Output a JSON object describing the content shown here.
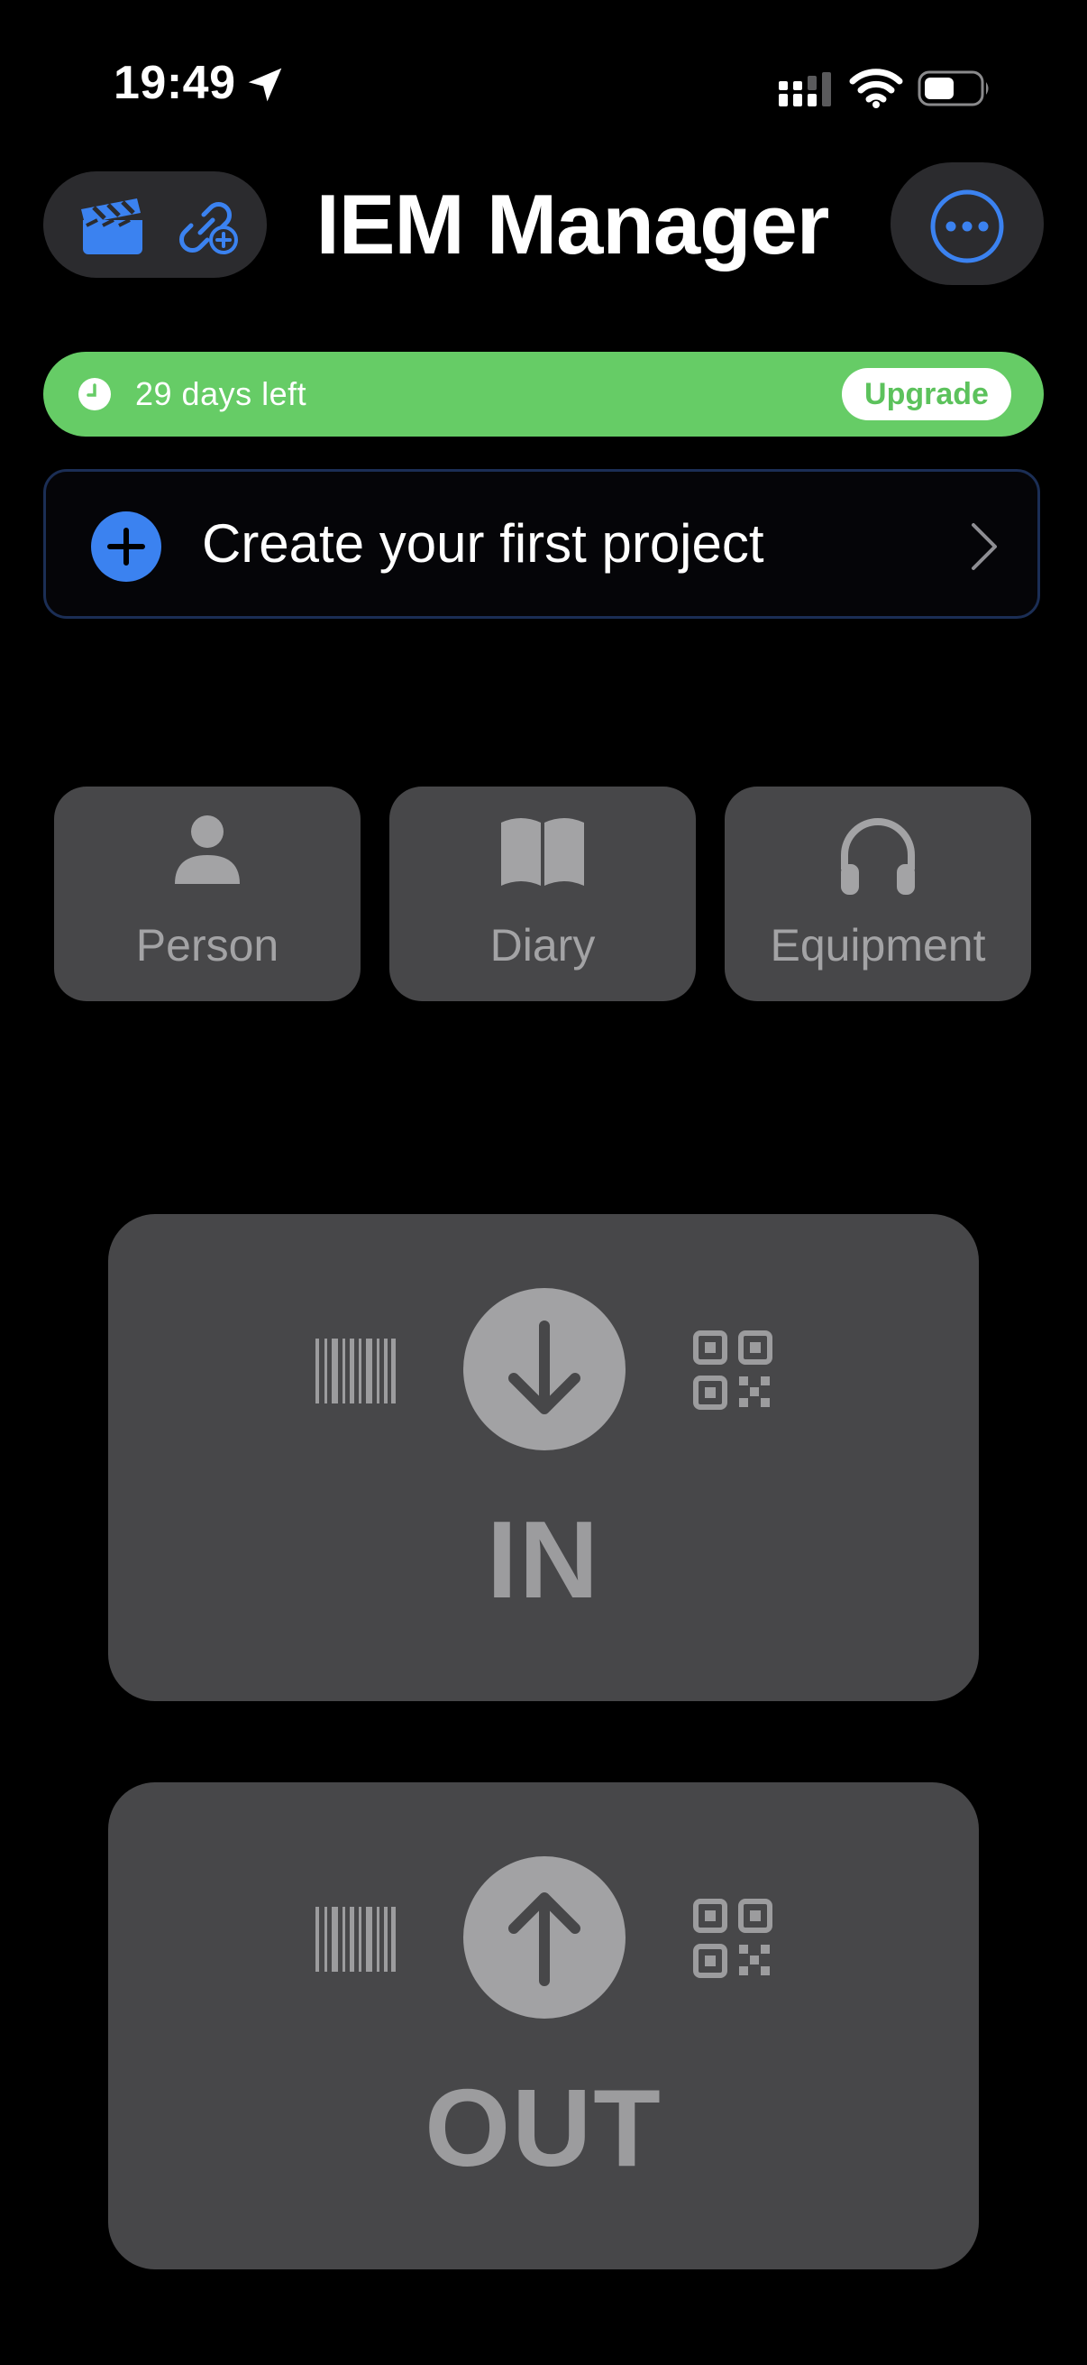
{
  "status_bar": {
    "time": "19:49"
  },
  "header": {
    "title": "IEM Manager"
  },
  "trial_banner": {
    "text": "29 days left",
    "upgrade_label": "Upgrade"
  },
  "create_project": {
    "label": "Create your first project"
  },
  "tiles": [
    {
      "label": "Person",
      "icon": "person-icon"
    },
    {
      "label": "Diary",
      "icon": "book-icon"
    },
    {
      "label": "Equipment",
      "icon": "headphones-icon"
    }
  ],
  "scan_cards": [
    {
      "label": "IN",
      "icon": "arrow-down-icon"
    },
    {
      "label": "OUT",
      "icon": "arrow-up-icon"
    }
  ],
  "colors": {
    "background": "#000000",
    "accent_blue": "#3b82f0",
    "trial_green": "#66cc66",
    "tile_gray": "#474749",
    "tile_text": "#a3a3a5"
  }
}
